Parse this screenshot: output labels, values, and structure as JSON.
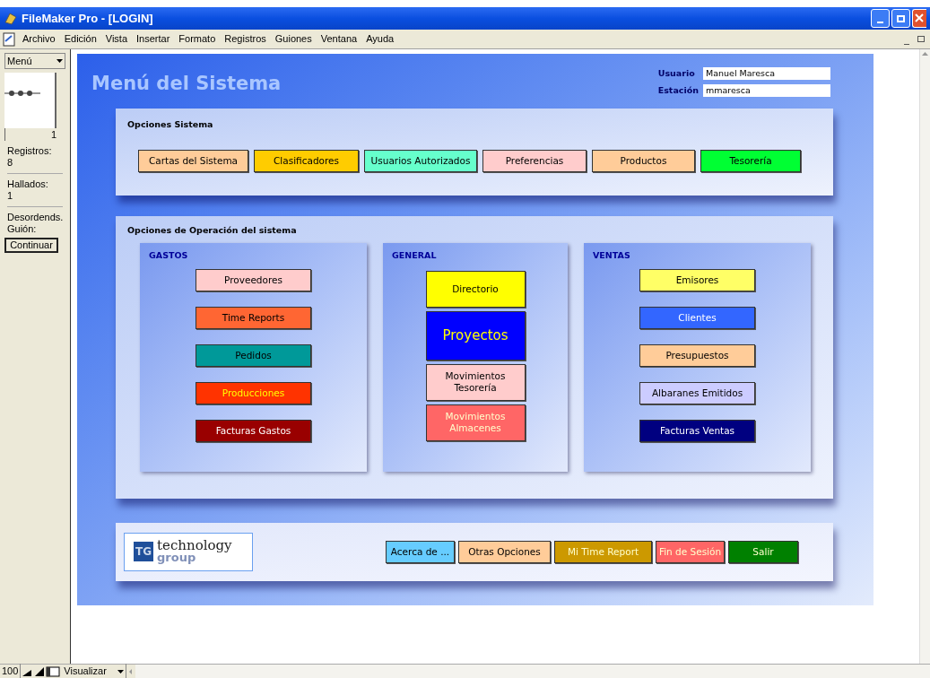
{
  "window": {
    "title": "FileMaker Pro - [LOGIN]"
  },
  "menu_bar": [
    "Archivo",
    "Edición",
    "Vista",
    "Insertar",
    "Formato",
    "Registros",
    "Guiones",
    "Ventana",
    "Ayuda"
  ],
  "sidebar": {
    "layout_menu": "Menú",
    "record_number": "1",
    "records_label": "Registros:",
    "records": "8",
    "found_label": "Hallados:",
    "found": "1",
    "sort_status": "Desordends.",
    "script_label": "Guión:",
    "continue_button": "Continuar"
  },
  "layout": {
    "title": "Menú del Sistema",
    "user_label": "Usuario",
    "user_value": "Manuel Maresca",
    "station_label": "Estación",
    "station_value": "mmaresca",
    "system_options": {
      "title": "Opciones Sistema",
      "buttons": [
        {
          "label": "Cartas del Sistema",
          "color": "#ffcc99",
          "kind": "standard"
        },
        {
          "label": "Clasificadores",
          "color": "#ffcc00",
          "kind": "standard"
        },
        {
          "label": "Usuarios Autorizados",
          "color": "#66ffcc",
          "kind": "standard"
        },
        {
          "label": "Preferencias",
          "color": "#ffcccc",
          "kind": "standard"
        },
        {
          "label": "Productos",
          "color": "#ffcc99",
          "kind": "standard"
        },
        {
          "label": "Tesorería",
          "color": "#00ff33",
          "kind": "standard"
        }
      ]
    },
    "operations": {
      "title": "Opciones de Operación del sistema",
      "groups": [
        {
          "title": "GASTOS",
          "buttons": [
            {
              "label": "Proveedores",
              "color": "#ffcccc",
              "kind": "standard"
            },
            {
              "label": "Time Reports",
              "color": "#ff6633",
              "kind": "standard"
            },
            {
              "label": "Pedidos",
              "color": "#009999",
              "kind": "standard"
            },
            {
              "label": "Producciones",
              "color": "#ff3300",
              "kind": "accent"
            },
            {
              "label": "Facturas Gastos",
              "color": "#990000",
              "kind": "inverse"
            }
          ]
        },
        {
          "title": "GENERAL",
          "buttons": [
            {
              "label": "Directorio",
              "color": "#ffff00",
              "kind": "standard"
            },
            {
              "label": "Proyectos",
              "color": "#0000ff",
              "kind": "feature"
            },
            {
              "label": "Movimientos\nTesorería",
              "color": "#ffcccc",
              "kind": "standard"
            },
            {
              "label": "Movimientos\nAlmacenes",
              "color": "#ff6666",
              "kind": "soft"
            }
          ]
        },
        {
          "title": "VENTAS",
          "buttons": [
            {
              "label": "Emisores",
              "color": "#ffff66",
              "kind": "standard"
            },
            {
              "label": "Clientes",
              "color": "#3366ff",
              "kind": "inverse"
            },
            {
              "label": "Presupuestos",
              "color": "#ffcc99",
              "kind": "standard"
            },
            {
              "label": "Albaranes Emitidos",
              "color": "#ccccff",
              "kind": "standard"
            },
            {
              "label": "Facturas Ventas",
              "color": "#000080",
              "kind": "inverse"
            }
          ]
        }
      ]
    },
    "footer": {
      "logo_mark": "TG",
      "logo_word_1": "technology",
      "logo_word_2": "group",
      "buttons": [
        {
          "label": "Acerca de ...",
          "color": "#66ccff",
          "kind": "standard"
        },
        {
          "label": "Otras Opciones",
          "color": "#ffcc99",
          "kind": "standard"
        },
        {
          "label": "Mi Time Report",
          "color": "#cc9900",
          "kind": "soft"
        },
        {
          "label": "Fin de Sesión",
          "color": "#ff6666",
          "kind": "soft"
        },
        {
          "label": "Salir",
          "color": "#008000",
          "kind": "soft"
        }
      ]
    }
  },
  "status_bar": {
    "zoom": "100",
    "mode": "Visualizar"
  }
}
